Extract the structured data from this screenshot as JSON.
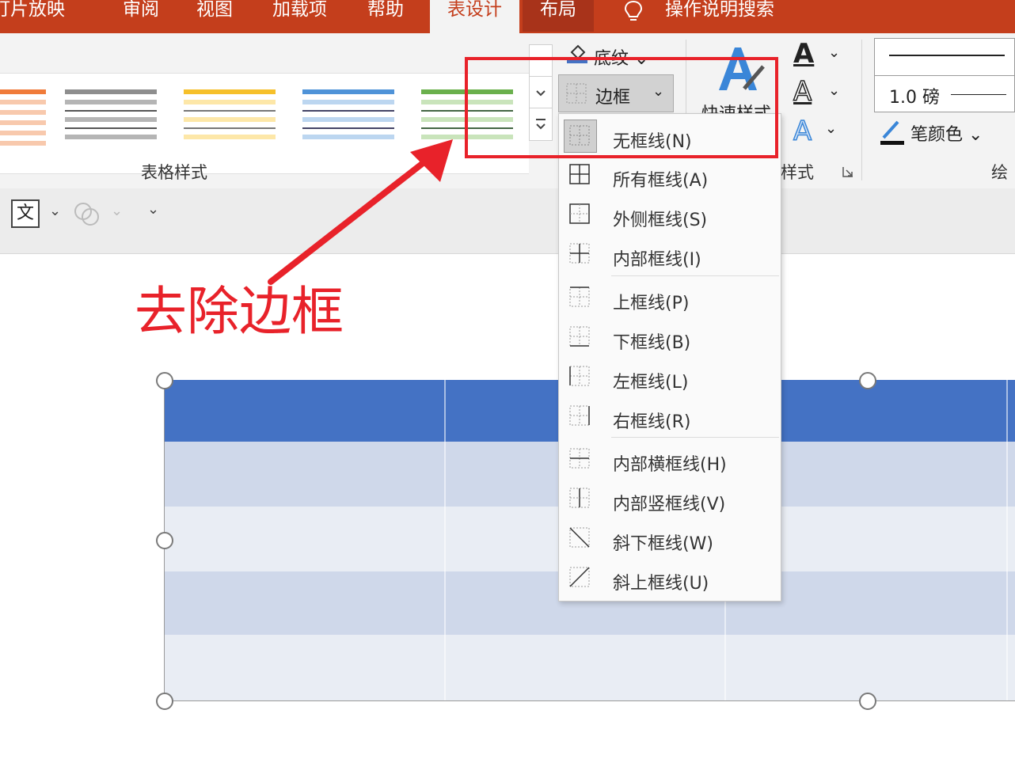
{
  "tabs": [
    {
      "label": "放映灯片放映",
      "key": "slideshow"
    },
    {
      "label": "审阅",
      "key": "review"
    },
    {
      "label": "视图",
      "key": "view"
    },
    {
      "label": "加载项",
      "key": "addins"
    },
    {
      "label": "帮助",
      "key": "help"
    },
    {
      "label": "表设计",
      "key": "table_design"
    },
    {
      "label": "布局",
      "key": "layout"
    },
    {
      "label": "操作说明搜索",
      "key": "search"
    }
  ],
  "ribbon": {
    "table_styles_label": "表格样式",
    "shading_label": "底纹",
    "border_label": "边框",
    "quick_styles_label": "快速样式",
    "wordart_group_label": "艺术字样式",
    "wordart_group_visible": "样式",
    "pen_weight_value": "1.0 磅",
    "pen_color_label": "笔颜色",
    "draw_group_label": "绘"
  },
  "colors": {
    "accent": "#c43e1c",
    "annotation_red": "#e8222a",
    "table_header": "#4472c4",
    "table_band_dark": "#cfd8ea",
    "table_band_light": "#e9edf4"
  },
  "annotation": {
    "text": "去除边框"
  },
  "border_menu": {
    "items": [
      {
        "label": "无框线(N)",
        "icon": "no-border-icon"
      },
      {
        "label": "所有框线(A)",
        "icon": "all-borders-icon"
      },
      {
        "label": "外侧框线(S)",
        "icon": "outside-borders-icon"
      },
      {
        "label": "内部框线(I)",
        "icon": "inside-borders-icon"
      },
      {
        "label": "上框线(P)",
        "icon": "top-border-icon"
      },
      {
        "label": "下框线(B)",
        "icon": "bottom-border-icon"
      },
      {
        "label": "左框线(L)",
        "icon": "left-border-icon"
      },
      {
        "label": "右框线(R)",
        "icon": "right-border-icon"
      },
      {
        "label": "内部横框线(H)",
        "icon": "inside-horizontal-border-icon"
      },
      {
        "label": "内部竖框线(V)",
        "icon": "inside-vertical-border-icon"
      },
      {
        "label": "斜下框线(W)",
        "icon": "diagonal-down-border-icon"
      },
      {
        "label": "斜上框线(U)",
        "icon": "diagonal-up-border-icon"
      }
    ]
  }
}
